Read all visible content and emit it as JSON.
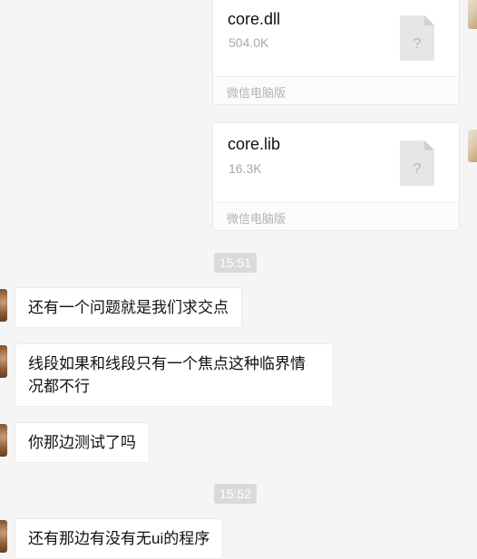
{
  "files": [
    {
      "name": "core.dll",
      "size": "504.0K",
      "footer": "微信电脑版",
      "icon": "unknown-file-icon"
    },
    {
      "name": "core.lib",
      "size": "16.3K",
      "footer": "微信电脑版",
      "icon": "unknown-file-icon"
    }
  ],
  "timestamps": [
    "15:51",
    "15:52"
  ],
  "messages": [
    {
      "text": "还有一个问题就是我们求交点"
    },
    {
      "text": "线段如果和线段只有一个焦点这种临界情况都不行"
    },
    {
      "text": "你那边测试了吗"
    },
    {
      "text": "还有那边有没有无ui的程序"
    }
  ],
  "file_icon_glyph": "?",
  "colors": {
    "background": "#f5f5f5",
    "bubble": "#ffffff",
    "timestamp_bg": "#dadada",
    "muted_text": "#a8a8a8"
  }
}
